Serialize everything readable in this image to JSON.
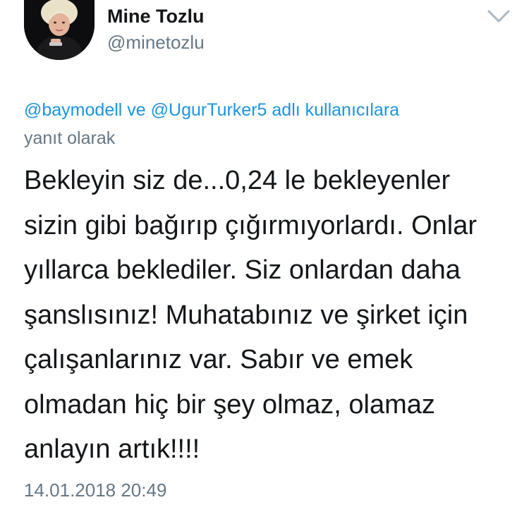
{
  "author": {
    "name": "Mine Tozlu",
    "handle": "@minetozlu"
  },
  "reply_context": {
    "mention_1": "@baymodell",
    "connector": "ve",
    "mention_2": "@UgurTurker5",
    "suffix_line1": "adlı kullanıcılara",
    "suffix_line2": "yanıt olarak"
  },
  "tweet": {
    "lines": [
      "Bekleyin siz de...0,24 le bekleyenler",
      "sizin gibi bağırıp çığırmıyorlardı. Onlar",
      "yıllarca beklediler. Siz onlardan daha",
      "şanslısınız! Muhatabınız ve şirket için",
      "çalışanlarınız var. Sabır ve emek",
      "olmadan hiç bir şey olmaz, olamaz",
      "anlayın artık!!!!"
    ],
    "timestamp": "14.01.2018 20:49"
  },
  "icons": {
    "menu": "chevron-down-icon"
  },
  "colors": {
    "text": "#14171a",
    "secondary": "#657786",
    "link": "#1b95e0",
    "background": "#ffffff"
  }
}
